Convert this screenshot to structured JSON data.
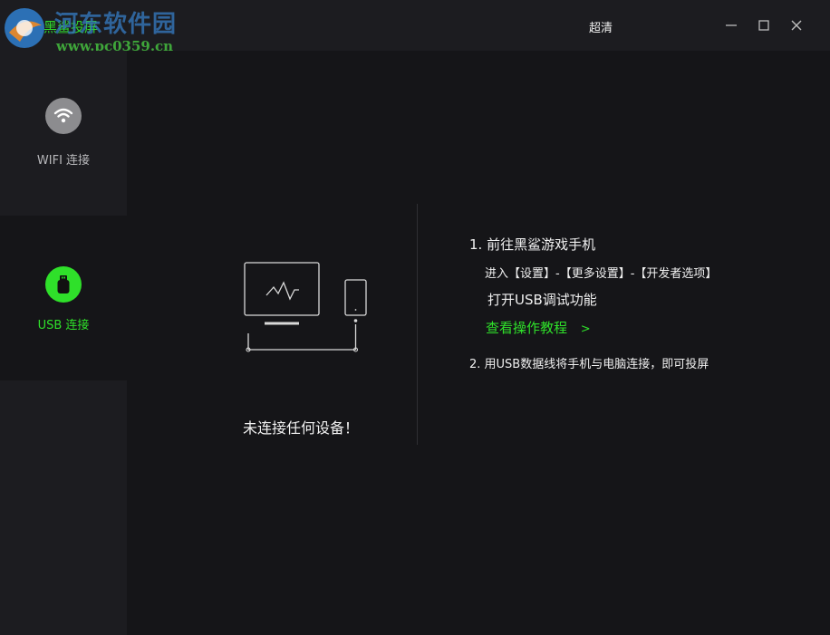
{
  "titlebar": {
    "app_title": "黑鲨投屏",
    "quality": "超清",
    "watermark_text": "河东软件园",
    "watermark_url": "www.pc0359.cn"
  },
  "sidebar": {
    "items": [
      {
        "label": "WIFI 连接",
        "icon": "wifi-icon",
        "active": false
      },
      {
        "label": "USB 连接",
        "icon": "usb-icon",
        "active": true
      }
    ]
  },
  "main": {
    "status": "未连接任何设备！",
    "step1_title": "1. 前往黑鲨游戏手机",
    "step1_path": "进入【设置】-【更多设置】-【开发者选项】",
    "step1_action": "打开USB调试功能",
    "tutorial_link": "查看操作教程",
    "tutorial_arrow": ">",
    "step2": "2. 用USB数据线将手机与电脑连接，即可投屏"
  },
  "colors": {
    "accent": "#2fe02a",
    "background": "#151518",
    "panel": "#1c1c20"
  }
}
